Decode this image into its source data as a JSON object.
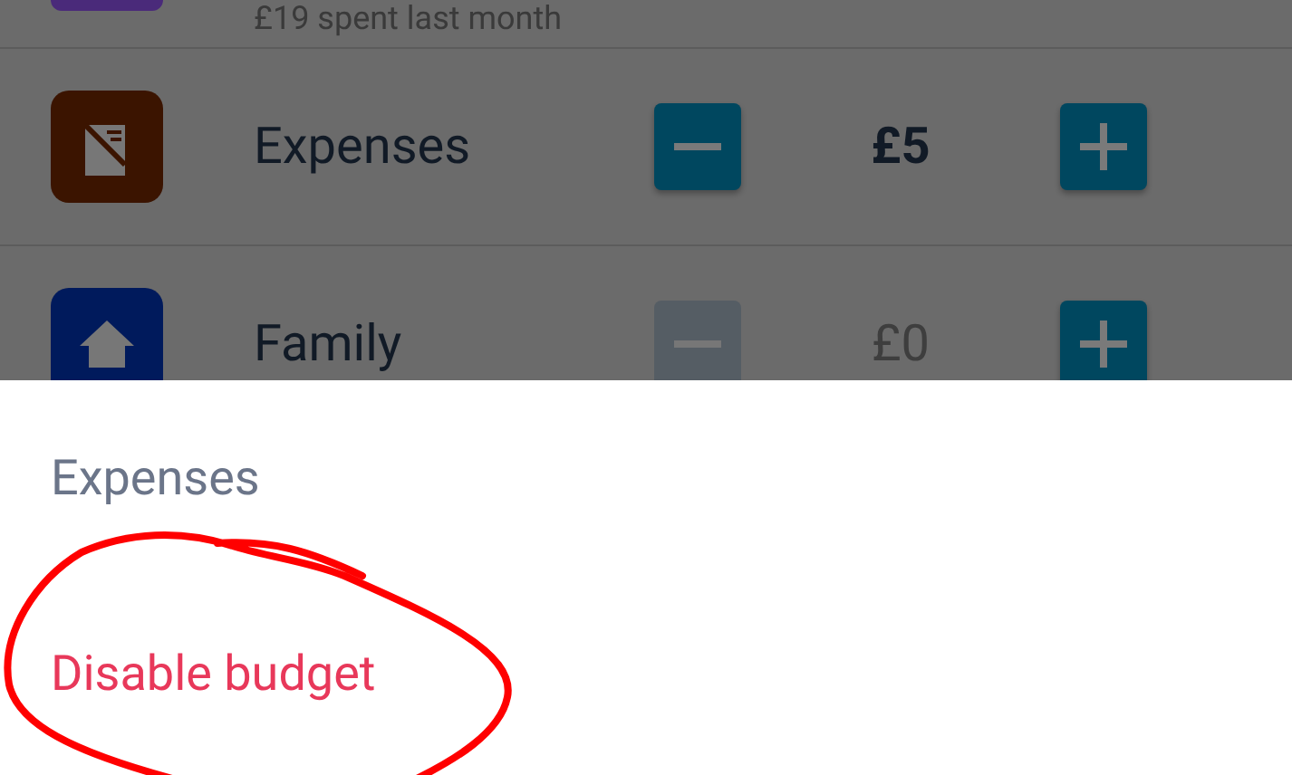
{
  "categories": [
    {
      "kind": "partial",
      "color": "#4a2a7a",
      "subtitle": "£19 spent last month"
    },
    {
      "kind": "receipt",
      "color": "#3b1400",
      "name": "Expenses",
      "amount": "£5",
      "minus_disabled": false
    },
    {
      "kind": "house",
      "color": "#001a5c",
      "name": "Family",
      "amount": "£0",
      "minus_disabled": true
    }
  ],
  "sheet": {
    "title": "Expenses",
    "actions": [
      {
        "label": "Disable budget",
        "kind": "danger"
      }
    ]
  }
}
